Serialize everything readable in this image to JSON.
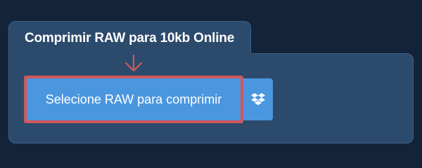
{
  "converter": {
    "title": "Comprimir RAW para 10kb Online",
    "upload_label": "Selecione RAW para comprimir",
    "dropbox_icon": "dropbox-icon",
    "arrow_icon": "arrow-down-icon"
  },
  "colors": {
    "page_background": "#13243a",
    "panel_background": "#2c4a6c",
    "button_blue": "#4a97e0",
    "highlight_red": "#d0585a"
  }
}
